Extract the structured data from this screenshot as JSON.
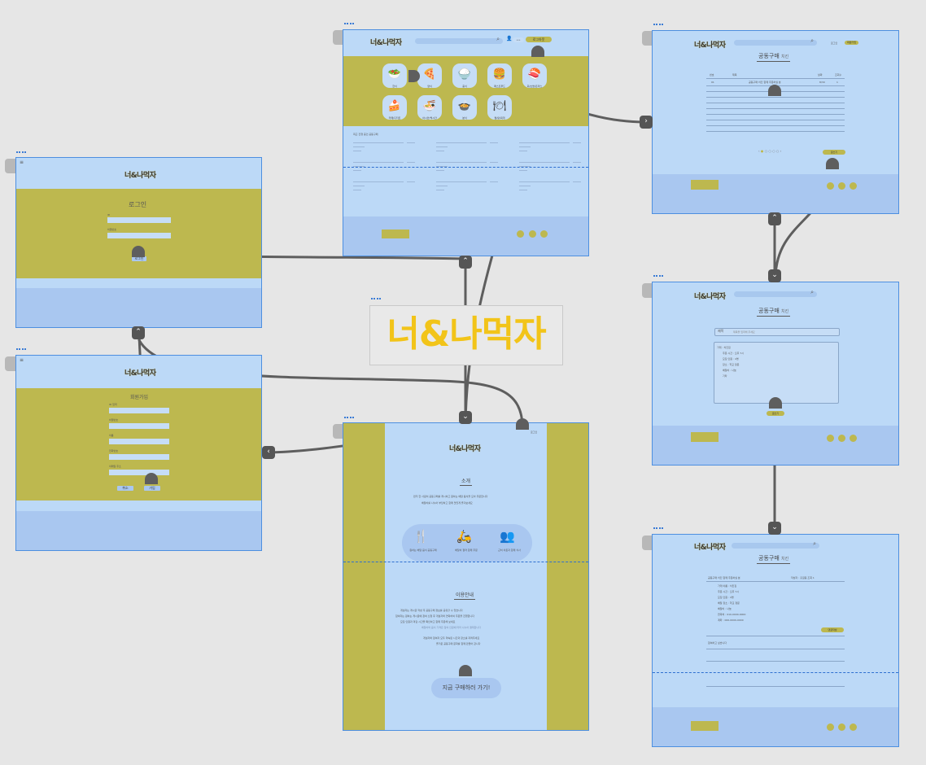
{
  "brand": {
    "name": "너&나먹자"
  },
  "colors": {
    "frame_bg": "#bcd9f7",
    "frame_border": "#4d8fe0",
    "accent": "#bdb84f",
    "brand_yellow": "#f2c419",
    "wire": "#5e5e5e",
    "canvas": "#e6e6e6"
  },
  "home": {
    "logo": "너&나먹자",
    "header_button": "로그아웃",
    "categories": [
      {
        "icon": "salad",
        "label": "한식"
      },
      {
        "icon": "pizza",
        "label": "양식"
      },
      {
        "icon": "rice-bowl",
        "label": "중식"
      },
      {
        "icon": "burger",
        "label": "패스트푸드"
      },
      {
        "icon": "sushi",
        "label": "회/초밥/돈까스"
      },
      {
        "icon": "cake",
        "label": "카페/디저트"
      },
      {
        "icon": "noodles",
        "label": "아시안/멕시칸"
      },
      {
        "icon": "ramen",
        "label": "분식"
      },
      {
        "icon": "plate",
        "label": "찜/탕/찌개"
      }
    ],
    "section_title": "최근 진행 중인 공동구매"
  },
  "login": {
    "logo": "너&나먹자",
    "title": "로그인",
    "id_label": "ID",
    "pw_label": "비밀번호",
    "button": "로그인"
  },
  "signup": {
    "logo": "너&나먹자",
    "title": "회원가입",
    "fields": [
      "ID 입력",
      "비밀번호",
      "이름",
      "전화번호",
      "이메일 주소"
    ],
    "cancel": "취소",
    "submit": "가입"
  },
  "landing": {
    "logo": "너&나먹자",
    "login_link": "로그인",
    "intro_title": "소개",
    "intro_line1": "먼저 한 사람이 공동구매를 게시하고 원하는 배달 음식을 모아 주문합니다",
    "intro_line2": "배달비를 나누어 부담하고 함께 맛있게 즐겨보세요",
    "features": [
      {
        "icon": "utensils",
        "label": "원하는 배달 음식 공동구매"
      },
      {
        "icon": "delivery",
        "label": "배달비 절약 함께 주문"
      },
      {
        "icon": "group",
        "label": "근처 이웃과 함께 식사"
      }
    ],
    "guide_title": "이용안내",
    "guide_lines": [
      "개설자는 게시글 작성 후 공동구매 정보를 공유할 수 있습니다",
      "참여자는 원하는 게시글에 참여 신청 후 개설자와 연락하여 주문을 진행합니다",
      "모집 인원과 마감 시간을 확인하고 함께 주문해 보세요"
    ],
    "guide_note": "배달비와 음식 가격은 참여 인원에 따라 나누어 결제합니다",
    "guide_line_last1": "개설자와 참여자 모두 약속된 시간과 장소를 지켜주세요",
    "guide_line_last2": "즐거운 공동구매 문화를 함께 만들어 갑니다",
    "cta": "지금 구매하러 가기!"
  },
  "list_page": {
    "logo": "너&나먹자",
    "title": "공동구매",
    "title_sub": "치킨",
    "header_link": "로그인",
    "header_button": "회원가입",
    "columns": [
      "번호",
      "제목",
      "날짜",
      "조회수"
    ],
    "first_row": [
      "01",
      "공동구매 치킨 함께 주문하실 분",
      "8/30",
      "1"
    ],
    "write_button": "글쓰기"
  },
  "write_page": {
    "logo": "너&나먹자",
    "title": "공동구매",
    "title_sub": "치킨",
    "subject_label": "제목",
    "subject_placeholder": "제목을 입력해 주세요",
    "body_lines": [
      "가게 : 치킨집",
      "주문 시간 : 오후 7시",
      "모집 인원 : 4명",
      "장소 : 학교 정문",
      "배달비 : 나눔",
      "기타"
    ],
    "submit": "글쓰기"
  },
  "detail_page": {
    "logo": "너&나먹자",
    "title": "공동구매",
    "title_sub": "치킨",
    "post_title": "공동구매 치킨 함께 주문하실 분",
    "post_meta": "작성자 : 홍길동   조회 1",
    "details": [
      "가게 이름 : 치킨집",
      "주문 시간 : 오후 7시",
      "모집 인원 : 4명",
      "배달 장소 : 학교 정문",
      "배달비 : 나눔",
      "연락처 : 010-0000-0000",
      "계좌 : 000-0000-0000"
    ],
    "comment_button": "댓글작성",
    "comment": "참여하고 싶습니다"
  }
}
